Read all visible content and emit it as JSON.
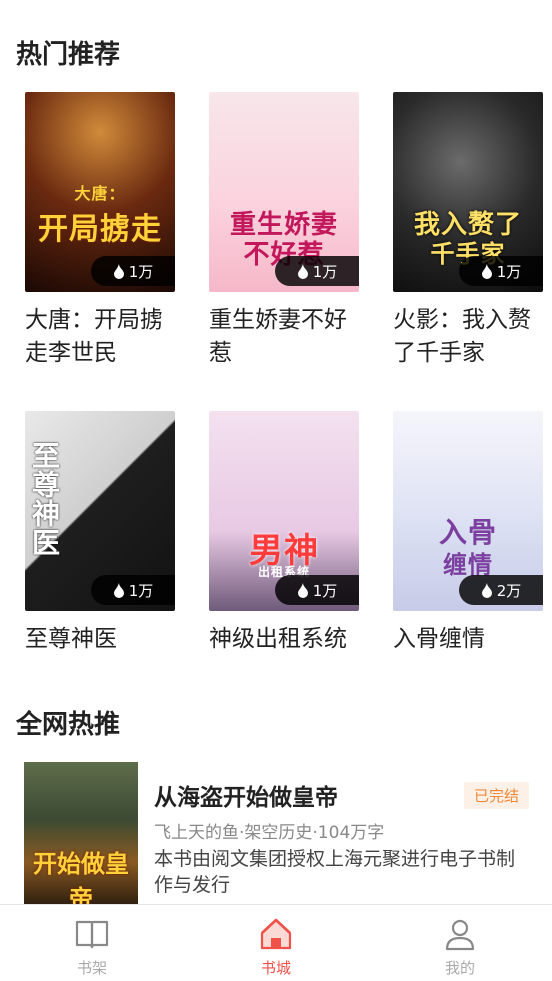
{
  "hot_section": {
    "title": "热门推荐",
    "books": [
      {
        "title": "大唐：开局掳走李世民",
        "heat": "1万",
        "cover_text": "开局掳走",
        "cover_sub": "大唐：",
        "color": "#ffd23a"
      },
      {
        "title": "重生娇妻不好惹",
        "heat": "1万",
        "cover_text": "重生娇妻",
        "cover_sub": "不好惹",
        "color": "#c2185b"
      },
      {
        "title": "火影：我入赘了千手家",
        "heat": "1万",
        "cover_text": "我入赘了",
        "cover_sub": "千手家",
        "color": "#ffe066"
      },
      {
        "title": "至尊神医",
        "heat": "1万",
        "cover_text": "至尊神医",
        "cover_sub": "",
        "color": "#ffffff"
      },
      {
        "title": "神级出租系统",
        "heat": "1万",
        "cover_text": "男神",
        "cover_sub": "出租系统",
        "color": "#ff3b3b"
      },
      {
        "title": "入骨缠情",
        "heat": "2万",
        "cover_text": "入骨",
        "cover_sub": "缠情",
        "color": "#7b3fa0"
      }
    ]
  },
  "net_section": {
    "title": "全网热推",
    "item": {
      "title": "从海盗开始做皇帝",
      "status": "已完结",
      "meta": "飞上天的鱼·架空历史·104万字",
      "desc": "本书由阅文集团授权上海元聚进行电子书制作与发行",
      "cover_text": "开始做皇帝"
    }
  },
  "nav": {
    "items": [
      {
        "label": "书架",
        "icon": "book-icon"
      },
      {
        "label": "书城",
        "icon": "home-icon",
        "active": true
      },
      {
        "label": "我的",
        "icon": "user-icon"
      }
    ]
  },
  "colors": {
    "accent": "#f0524a",
    "status_text": "#f08a3a",
    "status_bg": "#fdf0e6"
  }
}
